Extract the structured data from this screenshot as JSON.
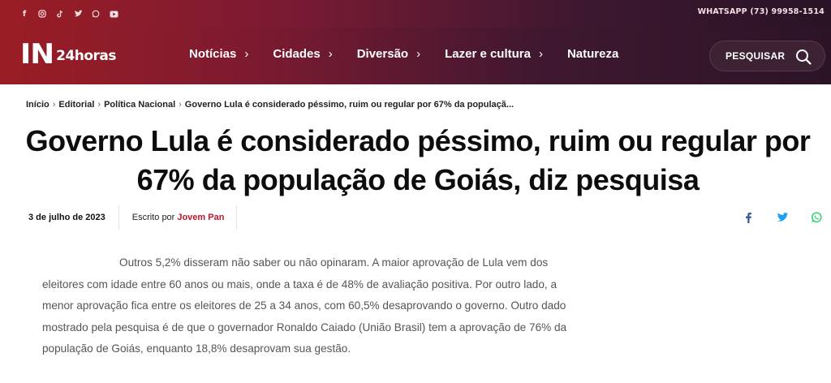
{
  "topbar": {
    "social_icons": [
      "facebook-icon",
      "instagram-icon",
      "tiktok-icon",
      "twitter-icon",
      "whatsapp-icon",
      "youtube-icon"
    ],
    "whatsapp_text": "WHATSAPP (73) 99958-1514"
  },
  "header": {
    "logo_main": "IN",
    "logo_sub": "24horas",
    "nav": [
      {
        "label": "Notícias",
        "has_chevron": true
      },
      {
        "label": "Cidades",
        "has_chevron": true
      },
      {
        "label": "Diversão",
        "has_chevron": true
      },
      {
        "label": "Lazer e cultura",
        "has_chevron": true
      },
      {
        "label": "Natureza",
        "has_chevron": false
      }
    ],
    "search_label": "PESQUISAR"
  },
  "breadcrumb": [
    "Início",
    "Editorial",
    "Política Nacional",
    "Governo Lula é considerado péssimo, ruim ou regular por 67% da populaçã..."
  ],
  "article": {
    "title": "Governo Lula é considerado péssimo, ruim ou regular por 67% da população de Goiás, diz pesquisa",
    "date": "3 de julho de 2023",
    "written_by": "Escrito por",
    "author": "Jovem Pan",
    "body": "Outros 5,2% disseram não saber ou não opinaram. A maior aprovação de Lula vem dos eleitores com idade entre 60 anos ou mais, onde a taxa é de 48% de avaliação positiva. Por outro lado, a menor aprovação fica entre os eleitores de 25 a 34 anos, com 60,5% desaprovando o governo. Outro dado mostrado pela pesquisa é de que o governador Ronaldo Caiado (União Brasil) tem a aprovação de 76% da população de Goiás, enquanto 18,8% desaprovam sua gestão."
  },
  "share_icons": [
    "facebook-share-icon",
    "twitter-share-icon",
    "whatsapp-share-icon"
  ],
  "colors": {
    "brand_red": "#9a1d24",
    "header_dark": "#2c1427",
    "author_red": "#c0162b",
    "facebook_blue": "#3b5998",
    "twitter_blue": "#1da1f2",
    "whatsapp_green": "#25d366"
  }
}
